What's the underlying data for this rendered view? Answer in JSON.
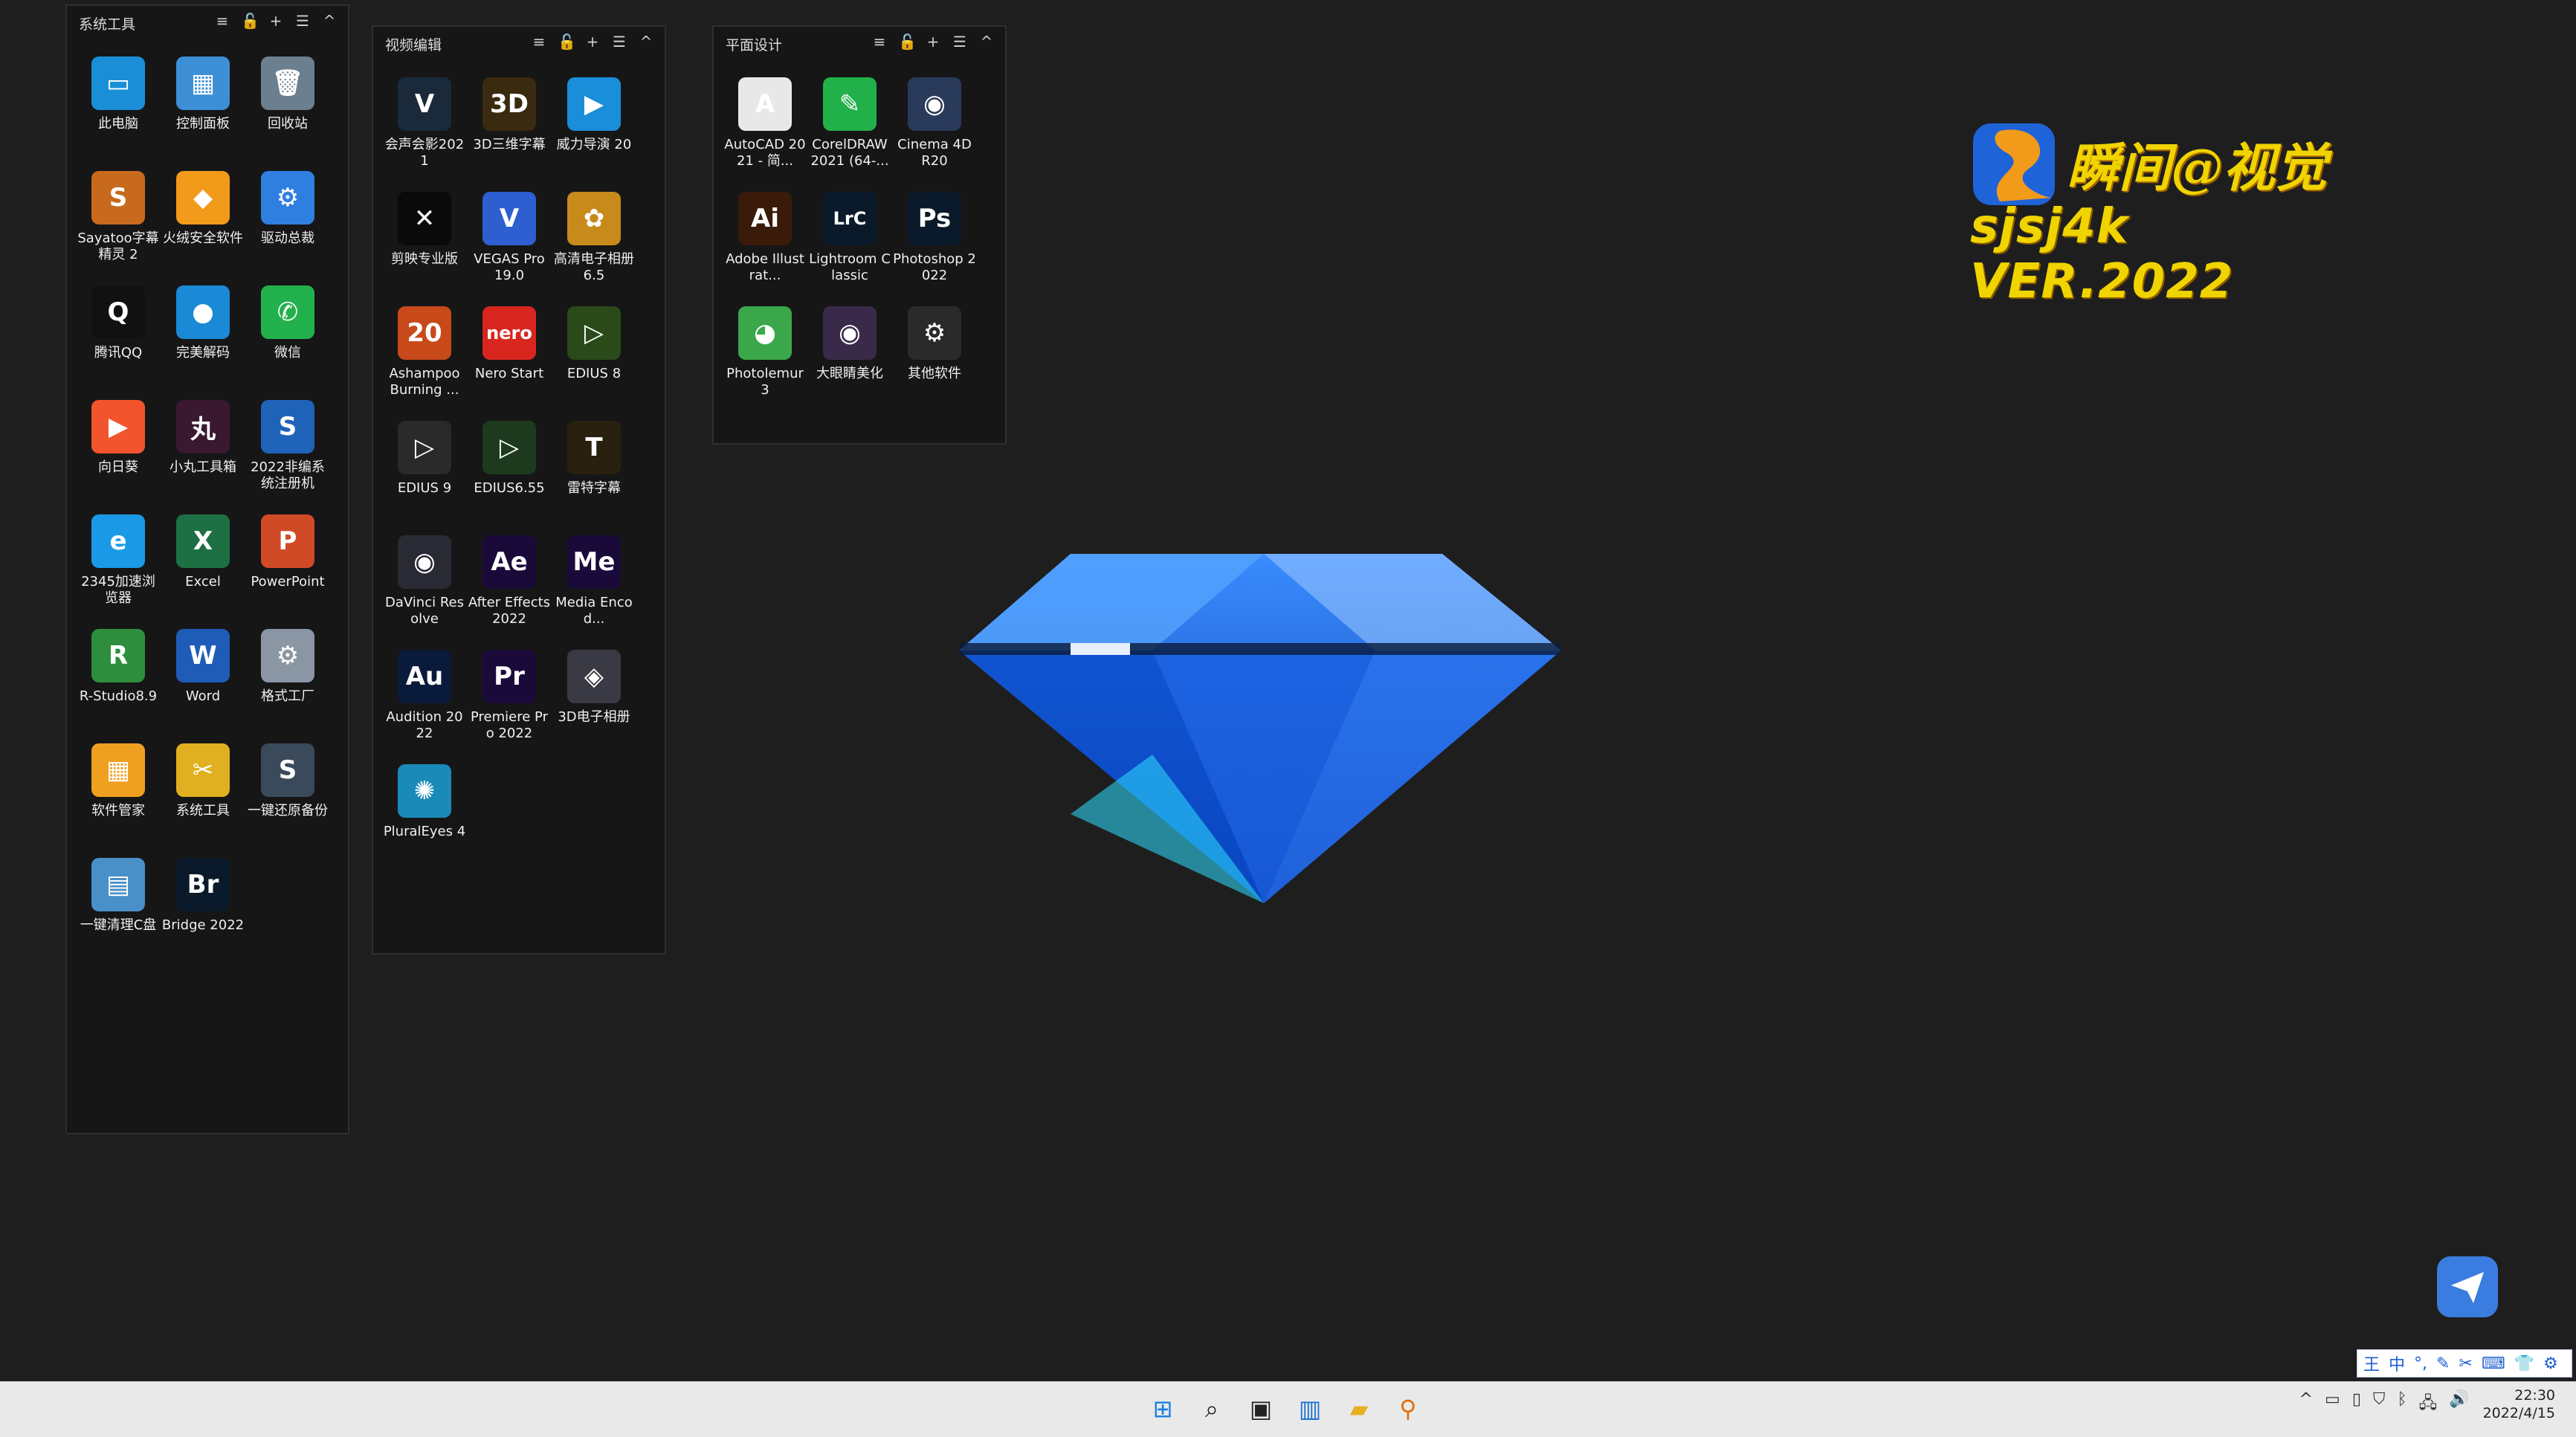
{
  "fences": [
    {
      "title": "系统工具",
      "items": [
        {
          "label": "此电脑",
          "glyph": "▭",
          "bg": "#1a8fd8",
          "icon": "monitor-icon"
        },
        {
          "label": "控制面板",
          "glyph": "▦",
          "bg": "#3d8fd6",
          "icon": "control-panel-icon"
        },
        {
          "label": "回收站",
          "glyph": "🗑",
          "bg": "#6c7f8f",
          "icon": "recycle-bin-icon"
        },
        {
          "label": "Sayatoo字幕精灵 2",
          "glyph": "S",
          "bg": "#c86a1e",
          "icon": "sayatoo-icon"
        },
        {
          "label": "火绒安全软件",
          "glyph": "◆",
          "bg": "#f29a1a",
          "icon": "huorong-shield-icon"
        },
        {
          "label": "驱动总裁",
          "glyph": "⚙",
          "bg": "#2f7fe0",
          "icon": "driver-gear-icon"
        },
        {
          "label": "腾讯QQ",
          "glyph": "Q",
          "bg": "#111111",
          "icon": "qq-penguin-icon"
        },
        {
          "label": "完美解码",
          "glyph": "●",
          "bg": "#1b8ad6",
          "icon": "player-icon"
        },
        {
          "label": "微信",
          "glyph": "✆",
          "bg": "#22b14c",
          "icon": "wechat-icon"
        },
        {
          "label": "向日葵",
          "glyph": "▶",
          "bg": "#f2542d",
          "icon": "sunflower-icon"
        },
        {
          "label": "小丸工具箱",
          "glyph": "丸",
          "bg": "#3a1830",
          "icon": "xiaowan-icon"
        },
        {
          "label": "2022非编系统注册机",
          "glyph": "S",
          "bg": "#1f63b8",
          "icon": "keygen-icon"
        },
        {
          "label": "2345加速浏览器",
          "glyph": "e",
          "bg": "#1a9ae6",
          "icon": "browser-icon"
        },
        {
          "label": "Excel",
          "glyph": "X",
          "bg": "#1d7044",
          "icon": "excel-icon"
        },
        {
          "label": "PowerPoint",
          "glyph": "P",
          "bg": "#d04a26",
          "icon": "powerpoint-icon"
        },
        {
          "label": "R-Studio8.9",
          "glyph": "R",
          "bg": "#2d8f3e",
          "icon": "rstudio-icon"
        },
        {
          "label": "Word",
          "glyph": "W",
          "bg": "#1f5cb8",
          "icon": "word-icon"
        },
        {
          "label": "格式工厂",
          "glyph": "⚙",
          "bg": "#8a96a3",
          "icon": "format-factory-icon"
        },
        {
          "label": "软件管家",
          "glyph": "▦",
          "bg": "#f0a020",
          "icon": "software-manager-icon"
        },
        {
          "label": "系统工具",
          "glyph": "✂",
          "bg": "#e0b020",
          "icon": "system-tools-icon"
        },
        {
          "label": "一键还原备份",
          "glyph": "S",
          "bg": "#3a4a5a",
          "icon": "restore-backup-icon"
        },
        {
          "label": "一键清理C盘",
          "glyph": "▤",
          "bg": "#4a90c8",
          "icon": "clean-disk-icon"
        },
        {
          "label": "Bridge 2022",
          "glyph": "Br",
          "bg": "#0b1a2a",
          "icon": "bridge-icon"
        }
      ]
    },
    {
      "title": "视频编辑",
      "items": [
        {
          "label": "会声会影2021",
          "glyph": "V",
          "bg": "#1a2a3a",
          "icon": "corel-video-icon"
        },
        {
          "label": "3D三维字幕",
          "glyph": "3D",
          "bg": "#3a2a10",
          "icon": "3d-title-icon"
        },
        {
          "label": "威力导演 20",
          "glyph": "▶",
          "bg": "#1a8ed8",
          "icon": "powerdirector-icon"
        },
        {
          "label": "剪映专业版",
          "glyph": "✕",
          "bg": "#0a0a0a",
          "icon": "capcut-icon"
        },
        {
          "label": "VEGAS Pro 19.0",
          "glyph": "V",
          "bg": "#2d5fd0",
          "icon": "vegas-icon"
        },
        {
          "label": "高清电子相册6.5",
          "glyph": "✿",
          "bg": "#c88a1a",
          "icon": "photo-album-icon"
        },
        {
          "label": "Ashampoo Burning ...",
          "glyph": "20",
          "bg": "#c84a1a",
          "icon": "ashampoo-icon"
        },
        {
          "label": "Nero Start",
          "glyph": "nero",
          "bg": "#d8261e",
          "icon": "nero-icon"
        },
        {
          "label": "EDIUS 8",
          "glyph": "▷",
          "bg": "#2a4a1a",
          "icon": "edius8-icon"
        },
        {
          "label": "EDIUS 9",
          "glyph": "▷",
          "bg": "#2a2a2a",
          "icon": "edius9-icon"
        },
        {
          "label": "EDIUS6.55",
          "glyph": "▷",
          "bg": "#1e3a1e",
          "icon": "edius655-icon"
        },
        {
          "label": "雷特字幕",
          "glyph": "T",
          "bg": "#2a2010",
          "icon": "leite-title-icon"
        },
        {
          "label": "DaVinci Resolve",
          "glyph": "◉",
          "bg": "#2a2a34",
          "icon": "davinci-icon"
        },
        {
          "label": "After Effects 2022",
          "glyph": "Ae",
          "bg": "#1a0a3a",
          "icon": "after-effects-icon"
        },
        {
          "label": "Media Encod...",
          "glyph": "Me",
          "bg": "#1a0a3a",
          "icon": "media-encoder-icon"
        },
        {
          "label": "Audition 2022",
          "glyph": "Au",
          "bg": "#0a1a3a",
          "icon": "audition-icon"
        },
        {
          "label": "Premiere Pro 2022",
          "glyph": "Pr",
          "bg": "#1a0a3a",
          "icon": "premiere-icon"
        },
        {
          "label": "3D电子相册",
          "glyph": "◈",
          "bg": "#3a3a44",
          "icon": "3d-album-icon"
        },
        {
          "label": "PluralEyes 4",
          "glyph": "✺",
          "bg": "#1a8ab8",
          "icon": "pluraleyes-icon"
        }
      ]
    },
    {
      "title": "平面设计",
      "items": [
        {
          "label": "AutoCAD 2021 - 简...",
          "glyph": "A",
          "bg": "#e8e8e8",
          "icon": "autocad-icon"
        },
        {
          "label": "CorelDRAW 2021 (64-...",
          "glyph": "✎",
          "bg": "#22b04a",
          "icon": "coreldraw-icon"
        },
        {
          "label": "Cinema 4D R20",
          "glyph": "◉",
          "bg": "#2a3a5a",
          "icon": "cinema4d-icon"
        },
        {
          "label": "Adobe Illustrat...",
          "glyph": "Ai",
          "bg": "#3a1a08",
          "icon": "illustrator-icon"
        },
        {
          "label": "Lightroom Classic",
          "glyph": "LrC",
          "bg": "#0a1a2a",
          "icon": "lightroom-icon"
        },
        {
          "label": "Photoshop 2022",
          "glyph": "Ps",
          "bg": "#0a1a2a",
          "icon": "photoshop-icon"
        },
        {
          "label": "Photolemur 3",
          "glyph": "◕",
          "bg": "#3aa84a",
          "icon": "photolemur-icon"
        },
        {
          "label": "大眼睛美化",
          "glyph": "◉",
          "bg": "#3a2a4a",
          "icon": "big-eye-icon"
        },
        {
          "label": "其他软件",
          "glyph": "⚙",
          "bg": "#2a2a2a",
          "icon": "other-software-icon"
        }
      ]
    }
  ],
  "fence_tools": [
    "≡",
    "🔓",
    "+",
    "☰",
    "^"
  ],
  "logo": {
    "cn": "瞬间@视觉",
    "en": "sjsj4k VER.2022"
  },
  "colors": {
    "desktop": "#1e1e1f",
    "fence": "#161617",
    "diamond": "#1a6fe8",
    "logo": "#f0d400"
  },
  "taskbar": {
    "apps": [
      {
        "name": "start-icon",
        "glyph": "⊞",
        "color": "#1a7fe0"
      },
      {
        "name": "search-icon",
        "glyph": "⌕",
        "color": "#222222"
      },
      {
        "name": "task-view-icon",
        "glyph": "▣",
        "color": "#222222"
      },
      {
        "name": "widgets-icon",
        "glyph": "▥",
        "color": "#1a6fd0"
      },
      {
        "name": "file-explorer-icon",
        "glyph": "▰",
        "color": "#e8b020"
      },
      {
        "name": "search-tool-icon",
        "glyph": "⚲",
        "color": "#e07010"
      }
    ],
    "tray": [
      "^",
      "▭",
      "▯",
      "⛉",
      "ᛒ",
      "🖧",
      "🔊"
    ],
    "time": "22:30",
    "date": "2022/4/15"
  },
  "ime": {
    "items": [
      "王",
      "中",
      "°,",
      "✎",
      "✂",
      "⌨",
      "👕",
      "⚙"
    ]
  }
}
